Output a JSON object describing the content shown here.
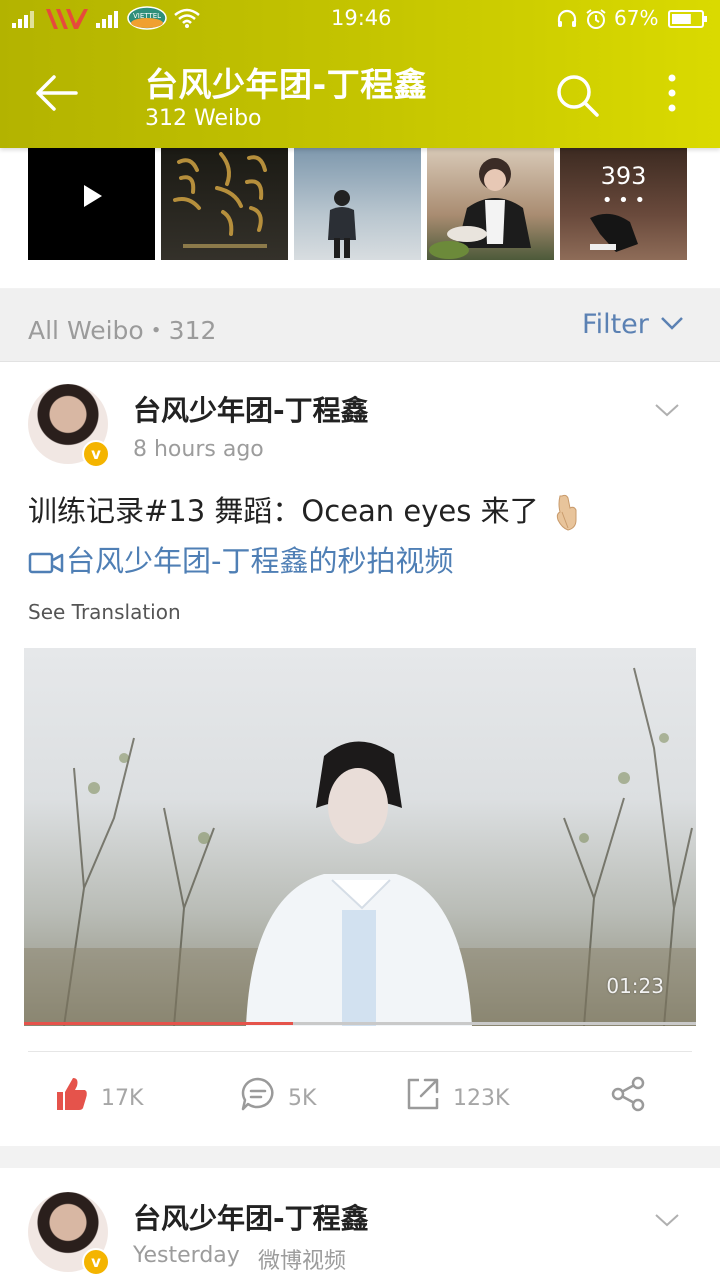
{
  "status_bar": {
    "time": "19:46",
    "battery_percent": "67%",
    "carrier_badge": "VIETTEL",
    "battery_level": 0.67
  },
  "header": {
    "title": "台风少年团-丁程鑫",
    "subtitle": "312 Weibo"
  },
  "photo_strip": {
    "more_count": "393",
    "more_dots": "• • •"
  },
  "filter_bar": {
    "label": "All Weibo・312",
    "filter_label": "Filter"
  },
  "posts": [
    {
      "author": "台风少年团-丁程鑫",
      "time": "8 hours ago",
      "verified_badge": "v",
      "text": "训练记录#13 舞蹈：Ocean eyes 来了",
      "link_text": "台风少年团-丁程鑫的秒拍视频",
      "see_translation": "See Translation",
      "video_duration": "01:23",
      "video_progress": 0.4,
      "likes": "17K",
      "comments": "5K",
      "reposts": "123K"
    },
    {
      "author": "台风少年团-丁程鑫",
      "time": "Yesterday",
      "source": "微博视频",
      "verified_badge": "v"
    }
  ],
  "colors": {
    "header_bg": "#c4c400",
    "link": "#4f7fb5",
    "like": "#e5534b",
    "verified": "#f4b400"
  }
}
